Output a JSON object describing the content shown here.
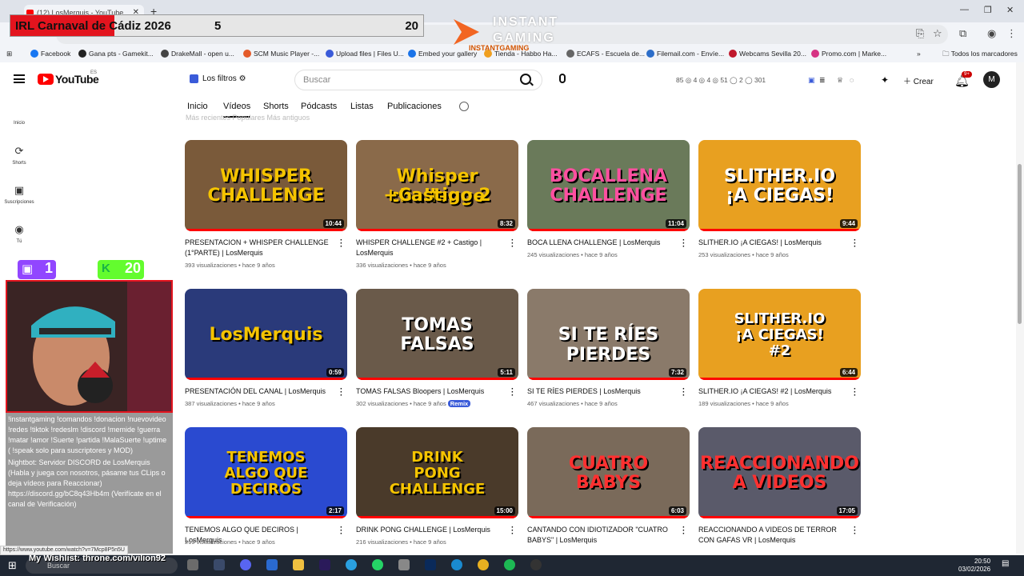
{
  "browser": {
    "tab_title": "(12) LosMerquis - YouTube",
    "bookmarks": [
      {
        "label": "Facebook",
        "color": "#1877f2"
      },
      {
        "label": "Gana pts - Gamekit...",
        "color": "#222222"
      },
      {
        "label": "DrakeMall - open u...",
        "color": "#444444"
      },
      {
        "label": "SCM Music Player -...",
        "color": "#e45b2a"
      },
      {
        "label": "Upload files | Files U...",
        "color": "#3a5bd9"
      },
      {
        "label": "Embed your gallery",
        "color": "#1a73e8"
      },
      {
        "label": "Tienda - Habbo Ha...",
        "color": "#f0a020"
      },
      {
        "label": "ECAFS - Escuela de...",
        "color": "#666666"
      },
      {
        "label": "Filemail.com - Envíe...",
        "color": "#2d6ec9"
      },
      {
        "label": "Webcams Sevilla 20...",
        "color": "#c0182c"
      },
      {
        "label": "Promo.com | Marke...",
        "color": "#d63384"
      }
    ],
    "all_bookmarks_label": "Todos los marcadores",
    "status_url": "https://www.youtube.com/watch?v=7Mcp8P5n5U"
  },
  "scoreboard": {
    "title": "IRL Carnaval de Cádiz 2026",
    "score_a": "5",
    "score_b": "20"
  },
  "instant_gaming": {
    "text1": "INSTANT",
    "text2": "GAMING",
    "url": "INSTANTGAMING"
  },
  "youtube": {
    "logo_text": "YouTube",
    "country": "ES",
    "filters_label": "Los filtros",
    "search_placeholder": "Buscar",
    "stats": "85  ◎ 4  ◎ 4  ◎ 51  ◯ 2  ◯ 301",
    "create_label": "Crear",
    "notif_badge": "9+",
    "avatar_letter": "M",
    "sidebar": [
      {
        "icon": "⌂",
        "label": "Inicio"
      },
      {
        "icon": "⟳",
        "label": "Shorts"
      },
      {
        "icon": "▣",
        "label": "Suscripciones"
      },
      {
        "icon": "◉",
        "label": "Tú"
      }
    ],
    "channel_tabs": [
      "Inicio",
      "Vídeos",
      "Shorts",
      "Pódcasts",
      "Listas",
      "Publicaciones"
    ],
    "active_tab": "Vídeos",
    "chips_faded": "Más recientes    Populares    Más antiguos"
  },
  "videos": [
    {
      "title": "PRESENTACION + WHISPER CHALLENGE (1°PARTE) | LosMerquis",
      "views": "393 visualizaciones",
      "age": "hace 9 años",
      "duration": "10:44",
      "thumb_text": "WHISPER\nCHALLENGE",
      "bg": "#7a5a3a",
      "fg": "#f5c400"
    },
    {
      "title": "WHISPER CHALLENGE #2 + Castigo | LosMerquis",
      "views": "336 visualizaciones",
      "age": "hace 9 años",
      "duration": "8:32",
      "thumb_text": "Whisper challenge\n+Castigo 2",
      "bg": "#8a6a4a",
      "fg": "#f5c400"
    },
    {
      "title": "BOCA LLENA CHALLENGE | LosMerquis",
      "views": "245 visualizaciones",
      "age": "hace 9 años",
      "duration": "11:04",
      "thumb_text": "BOCALLENA\nCHALLENGE",
      "bg": "#6a7a5a",
      "fg": "#ff4fa0"
    },
    {
      "title": "SLITHER.IO ¡A CIEGAS! | LosMerquis",
      "views": "253 visualizaciones",
      "age": "hace 9 años",
      "duration": "9:44",
      "thumb_text": "SLITHER.IO\n¡A CIEGAS!",
      "bg": "#e8a020",
      "fg": "#ffffff"
    },
    {
      "title": "PRESENTACIÓN DEL CANAL | LosMerquis",
      "views": "387 visualizaciones",
      "age": "hace 9 años",
      "duration": "0:59",
      "thumb_text": "LosMerquis",
      "bg": "#2a3a7a",
      "fg": "#f5c400"
    },
    {
      "title": "TOMAS FALSAS Bloopers | LosMerquis",
      "views": "302 visualizaciones",
      "age": "hace 9 años",
      "duration": "5:11",
      "thumb_text": "TOMAS\nFALSAS",
      "bg": "#6a5a4a",
      "fg": "#ffffff",
      "badge": "Remix"
    },
    {
      "title": "SI TE RÍES PIERDES | LosMerquis",
      "views": "467 visualizaciones",
      "age": "hace 9 años",
      "duration": "7:32",
      "thumb_text": "SI TE RÍES PIERDES",
      "bg": "#8a7a6a",
      "fg": "#ffffff"
    },
    {
      "title": "SLITHER.IO ¡A CIEGAS! #2 | LosMerquis",
      "views": "189 visualizaciones",
      "age": "hace 9 años",
      "duration": "6:44",
      "thumb_text": "SLITHER.IO\n¡A CIEGAS!\n#2",
      "bg": "#e8a020",
      "fg": "#ffffff"
    },
    {
      "title": "TENEMOS ALGO QUE DECIROS | LosMerquis",
      "views": "219 visualizaciones",
      "age": "hace 9 años",
      "duration": "2:17",
      "thumb_text": "TENEMOS\nALGO QUE\nDECIROS",
      "bg": "#2a4ad0",
      "fg": "#f5c400"
    },
    {
      "title": "DRINK PONG CHALLENGE | LosMerquis",
      "views": "216 visualizaciones",
      "age": "hace 9 años",
      "duration": "15:00",
      "thumb_text": "DRINK\nPONG\nCHALLENGE",
      "bg": "#4a3a2a",
      "fg": "#f5c400"
    },
    {
      "title": "CANTANDO CON IDIOTIZADOR \"CUATRO BABYS\" | LosMerquis",
      "views": "",
      "age": "",
      "duration": "6:03",
      "thumb_text": "CUATRO\nBABYS",
      "bg": "#7a6a5a",
      "fg": "#ff3030"
    },
    {
      "title": "REACCIONANDO A VIDEOS DE TERROR CON GAFAS VR | LosMerquis",
      "views": "",
      "age": "",
      "duration": "17:05",
      "thumb_text": "REACCIONANDO\nA VIDEOS",
      "bg": "#5a5a6a",
      "fg": "#ff3030"
    }
  ],
  "stream": {
    "twitch_count": "1",
    "kick_count": "20",
    "chat_lines": [
      "!instantgaming !comandos !donacion !nuevovideo !redes !tiktok !redeslm !discord !memide !guerra !matar !amor !Suerte !partida !MalaSuerte !uptime ( !speak solo para suscriptores y MOD)",
      "Nightbot: Servidor DISCORD de LosMerquis (Habla y juega con nosotros, pásame tus CLips o deja vídeos para Reaccionar) https://discord.gg/bC8q43Hb4m (Verifícate en el canal de Verificación)"
    ],
    "wishlist": "My Wishlist: throne.com/vilion92"
  },
  "taskbar": {
    "search_placeholder": "Buscar",
    "time": "20:50",
    "date": "03/02/2026"
  }
}
